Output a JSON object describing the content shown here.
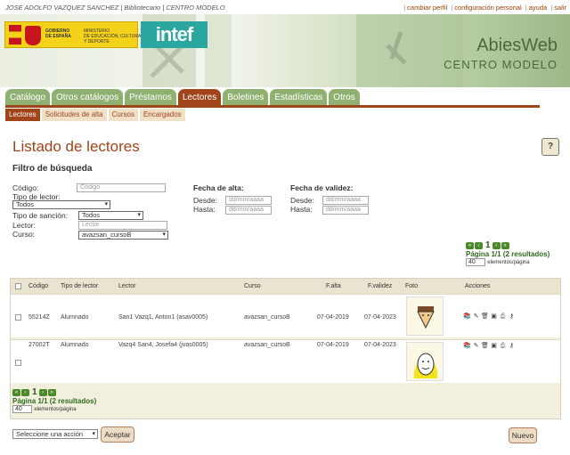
{
  "topbar": {
    "user": "JOSE ADOLFO VAZQUEZ SANCHEZ | Bibliotecario | CENTRO MODELO",
    "links": [
      "cambiar perfil",
      "configuración personal",
      "ayuda",
      "salir"
    ]
  },
  "header": {
    "gov_text_1": "GOBIERNO\nDE ESPAÑA",
    "gov_text_2": "MINISTERIO\nDE EDUCACIÓN, CULTURA\nY DEPORTE",
    "intef": "intef",
    "app_title": "AbiesWeb",
    "app_subtitle": "CENTRO MODELO"
  },
  "main_tabs": [
    "Catálogo",
    "Otros catálogos",
    "Préstamos",
    "Lectores",
    "Boletines",
    "Estadísticas",
    "Otros"
  ],
  "sub_tabs": [
    "Lectores",
    "Solicitudes de alta",
    "Cursos",
    "Encargados"
  ],
  "page": {
    "title": "Listado de lectores",
    "help": "?"
  },
  "filter": {
    "title": "Filtro de búsqueda",
    "codigo_label": "Código:",
    "codigo_placeholder": "Código",
    "tipo_lector_label": "Tipo de lector:",
    "tipo_lector_value": "Todos",
    "tipo_sancion_label": "Tipo de sanción:",
    "tipo_sancion_value": "Todos",
    "lector_label": "Lector:",
    "lector_placeholder": "Lector",
    "curso_label": "Curso:",
    "curso_value": "avazsan_cursoB",
    "fecha_alta_label": "Fecha de alta:",
    "fecha_validez_label": "Fecha de validez:",
    "desde_label": "Desde:",
    "hasta_label": "Hasta:",
    "date_placeholder": "dd/mm/aaaa"
  },
  "pager": {
    "page": "1",
    "info": "Página 1/1 (2 resultados)",
    "per_page": "40",
    "per_page_label": "elementos/página"
  },
  "table": {
    "headers": [
      "Código",
      "Tipo de lector",
      "Lector",
      "Curso",
      "F.alta",
      "F.validez",
      "Foto",
      "Acciones"
    ],
    "rows": [
      {
        "codigo": "55214Z",
        "tipo": "Alumnado",
        "lector": "San1 Vazq1, Anton1 (asav0005)",
        "curso": "avazsan_cursoB",
        "alta": "07-04-2019",
        "validez": "07-04-2023"
      },
      {
        "codigo": "27002T",
        "tipo": "Alumnado",
        "lector": "Vazq4 San4, Josefa4 (jvas0005)",
        "curso": "avazsan_cursoB",
        "alta": "07-04-2019",
        "validez": "07-04-2023"
      }
    ]
  },
  "footer": {
    "action_select": "Seleccione una acción",
    "accept": "Aceptar",
    "new": "Nuevo"
  }
}
